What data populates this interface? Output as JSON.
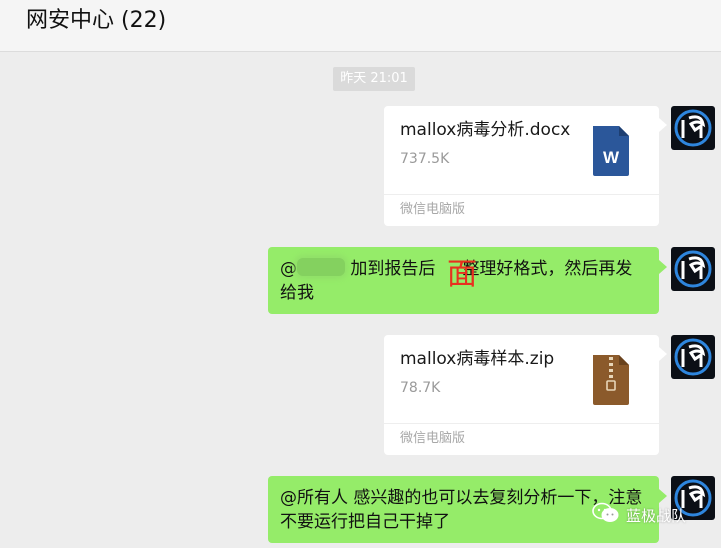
{
  "header": {
    "title": "网安中心 (22)"
  },
  "timestamp": "昨天 21:01",
  "messages": {
    "file1": {
      "name": "mallox病毒分析.docx",
      "size": "737.5K",
      "source": "微信电脑版",
      "icon": "word-doc-icon",
      "icon_letter": "W"
    },
    "text1": {
      "mention": "@",
      "text": "加到报告后",
      "text2": "整理好格式，然后再发给我"
    },
    "overlay_char": "面",
    "file2": {
      "name": "mallox病毒样本.zip",
      "size": "78.7K",
      "source": "微信电脑版",
      "icon": "zip-archive-icon"
    },
    "text2": {
      "text": "@所有人 感兴趣的也可以去复刻分析一下，注意不要运行把自己干掉了"
    }
  },
  "watermark": {
    "text": "蓝极战队",
    "icon": "wechat-icon"
  },
  "colors": {
    "bubble_green": "#95ec69",
    "background": "#ededed",
    "word_blue": "#2b579a",
    "zip_brown": "#8b5a2b"
  }
}
